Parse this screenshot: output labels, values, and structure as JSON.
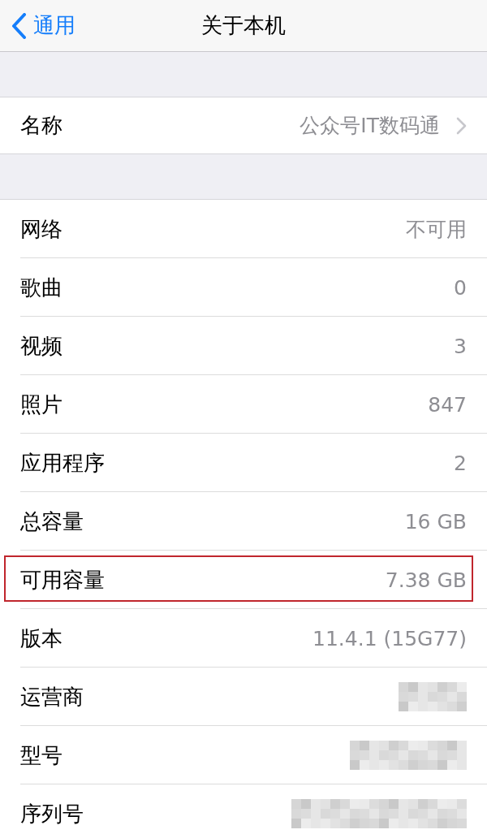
{
  "nav": {
    "back": "通用",
    "title": "关于本机"
  },
  "sections": [
    {
      "rows": [
        {
          "label": "名称",
          "value": "公众号IT数码通",
          "kind": "disclosure",
          "highlighted": false
        }
      ]
    },
    {
      "rows": [
        {
          "label": "网络",
          "value": "不可用",
          "kind": "value",
          "highlighted": false
        },
        {
          "label": "歌曲",
          "value": "0",
          "kind": "value",
          "highlighted": false
        },
        {
          "label": "视频",
          "value": "3",
          "kind": "value",
          "highlighted": false
        },
        {
          "label": "照片",
          "value": "847",
          "kind": "value",
          "highlighted": false
        },
        {
          "label": "应用程序",
          "value": "2",
          "kind": "value",
          "highlighted": false
        },
        {
          "label": "总容量",
          "value": "16 GB",
          "kind": "value",
          "highlighted": false
        },
        {
          "label": "可用容量",
          "value": "7.38 GB",
          "kind": "value",
          "highlighted": true
        },
        {
          "label": "版本",
          "value": "11.4.1 (15G77)",
          "kind": "value",
          "highlighted": false
        },
        {
          "label": "运营商",
          "kind": "blurred",
          "highlighted": false
        },
        {
          "label": "型号",
          "kind": "blurred",
          "highlighted": false
        },
        {
          "label": "序列号",
          "kind": "blurred",
          "highlighted": false
        }
      ]
    }
  ]
}
